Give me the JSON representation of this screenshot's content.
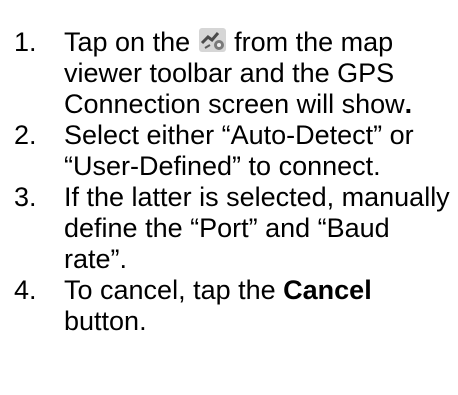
{
  "steps": [
    {
      "number": "1.",
      "text_before": "Tap on the",
      "icon": "gps-connection-icon",
      "text_after": "from the map viewer toolbar and the GPS Connection screen will show",
      "text_bold": "."
    },
    {
      "number": "2.",
      "text": "Select either “Auto-Detect” or “User-Defined” to connect."
    },
    {
      "number": "3.",
      "text": "If the latter is selected, manually define the “Port” and “Baud rate”."
    },
    {
      "number": "4.",
      "text_before": "To cancel, tap the",
      "text_bold": "Cancel",
      "text_after": "button."
    }
  ]
}
